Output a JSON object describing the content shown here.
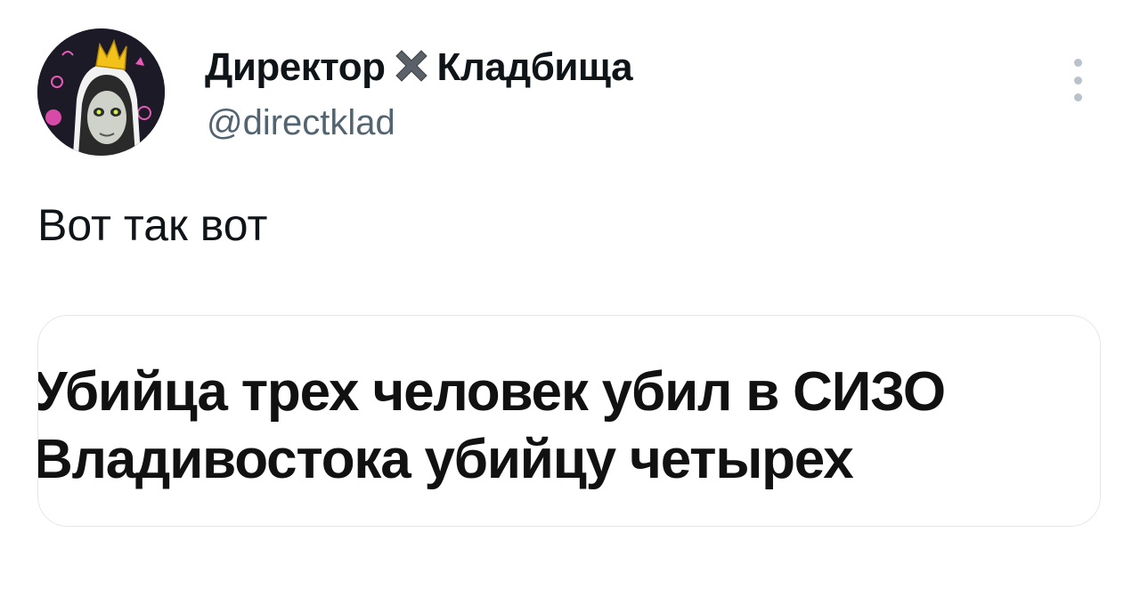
{
  "author": {
    "display_name_part1": "Директор",
    "display_name_emoji": "cross-mark-icon",
    "display_name_part2": "Кладбища",
    "handle": "@directklad",
    "avatar": "nun-with-crown-avatar"
  },
  "tweet": {
    "text": "Вот так вот"
  },
  "media": {
    "headline_line1": "Убийца трех человек убил в СИЗО",
    "headline_line2": "Владивостока убийцу четырех"
  },
  "actions": {
    "more_icon": "more-options-icon"
  },
  "colors": {
    "text_primary": "#0f1419",
    "text_secondary": "#536471",
    "card_border": "#e4e7ea",
    "avatar_bg": "#1c1a26"
  }
}
